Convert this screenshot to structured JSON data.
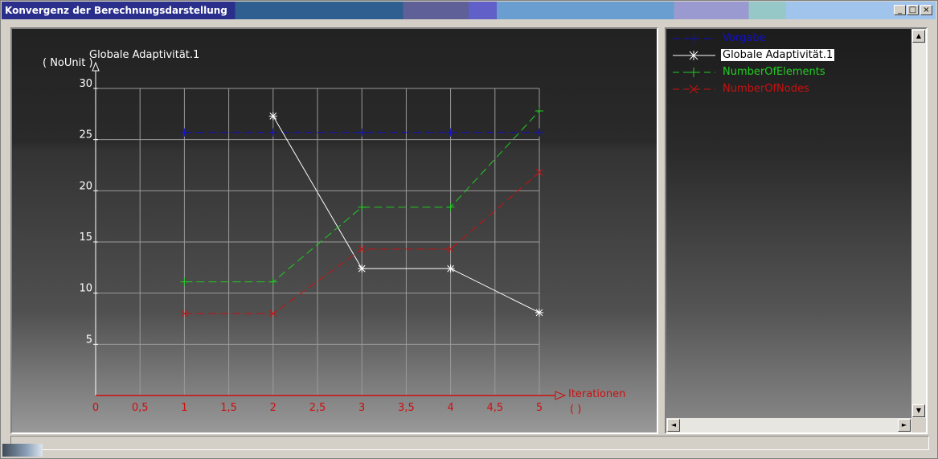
{
  "window": {
    "title": "Konvergenz der Berechnungsdarstellung",
    "buttons": {
      "minimize": "_",
      "maximize": "□",
      "close": "×"
    }
  },
  "chart_data": {
    "type": "line",
    "x": [
      1,
      2,
      3,
      4,
      5
    ],
    "xlim": [
      0,
      5
    ],
    "xticks": [
      "0",
      "0,5",
      "1",
      "1,5",
      "2",
      "2,5",
      "3",
      "3,5",
      "4",
      "4,5",
      "5"
    ],
    "ylim": [
      0,
      30
    ],
    "yticks": [
      "5",
      "10",
      "15",
      "20",
      "25",
      "30"
    ],
    "xlabel": "Iterationen",
    "xunit": "(  )",
    "ylabel": "Globale Adaptivität.1",
    "yunit": "( NoUnit )",
    "grid": true,
    "series": [
      {
        "name": "Vorgabe",
        "values": [
          25.7,
          25.7,
          25.7,
          25.7,
          25.7
        ],
        "color": "#1010c8",
        "style": "dashed",
        "marker": "plus"
      },
      {
        "name": "Globale Adaptivität.1",
        "values": [
          null,
          27.3,
          12.4,
          12.4,
          8.1
        ],
        "color": "#ffffff",
        "style": "solid",
        "marker": "asterisk"
      },
      {
        "name": "NumberOfElements",
        "values": [
          11.1,
          11.1,
          18.4,
          18.4,
          27.8
        ],
        "color": "#22cc22",
        "style": "dashed",
        "marker": "plus"
      },
      {
        "name": "NumberOfNodes",
        "values": [
          8.0,
          8.0,
          14.3,
          14.3,
          21.8
        ],
        "color": "#cc1010",
        "style": "dashed",
        "marker": "cross"
      }
    ]
  },
  "legend": {
    "selected_index": 1,
    "items": [
      {
        "label": "Vorgabe",
        "color": "#1010c8"
      },
      {
        "label": "Globale Adaptivität.1",
        "color": "#ffffff"
      },
      {
        "label": "NumberOfElements",
        "color": "#22cc22"
      },
      {
        "label": "NumberOfNodes",
        "color": "#cc1010"
      }
    ]
  },
  "scrollbar": {
    "up": "▲",
    "down": "▼",
    "left": "◄",
    "right": "►"
  }
}
